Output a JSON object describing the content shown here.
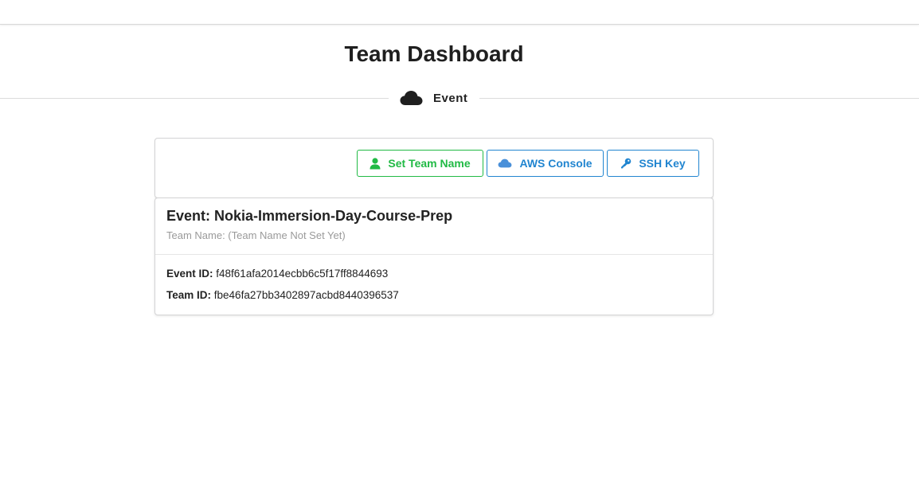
{
  "page": {
    "title": "Team Dashboard"
  },
  "section": {
    "label": "Event",
    "icon": "cloud-icon"
  },
  "actions": {
    "set_team_name": {
      "label": "Set Team Name",
      "icon": "user-icon",
      "color": "#21ba45"
    },
    "aws_console": {
      "label": "AWS Console",
      "icon": "cloud-icon",
      "color": "#2185d0"
    },
    "ssh_key": {
      "label": "SSH Key",
      "icon": "key-icon",
      "color": "#2185d0"
    }
  },
  "event": {
    "title": "Event: Nokia-Immersion-Day-Course-Prep",
    "team_name_line": "Team Name: (Team Name Not Set Yet)",
    "event_id_label": "Event ID:",
    "event_id": "f48f61afa2014ecbb6c5f17ff8844693",
    "team_id_label": "Team ID:",
    "team_id": "fbe46fa27bb3402897acbd8440396537"
  }
}
